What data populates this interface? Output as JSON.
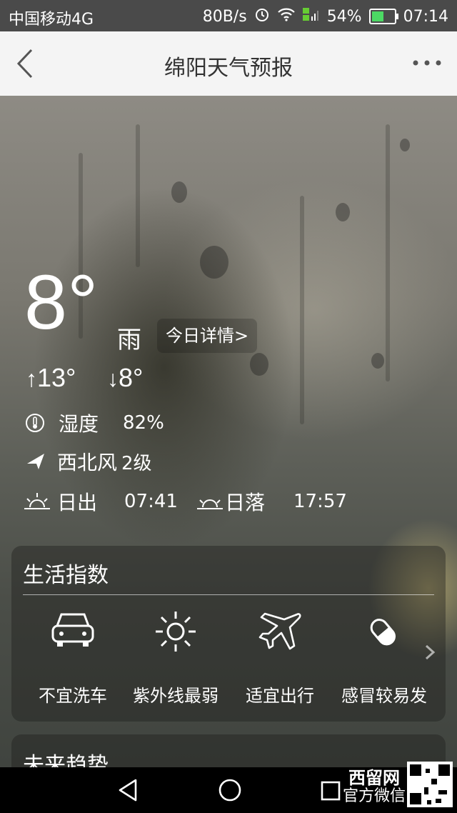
{
  "status_bar": {
    "carrier": "中国移动4G",
    "speed": "80B/s",
    "battery": "54%",
    "battery_level": 0.54,
    "time": "07:14"
  },
  "nav": {
    "title": "绵阳天气预报"
  },
  "weather": {
    "temperature": "8°",
    "condition": "雨",
    "detail_link": "今日详情>",
    "high": "13°",
    "low": "8°",
    "humidity_label": "湿度",
    "humidity_value": "82%",
    "wind": "西北风",
    "wind_level": "2级",
    "sunrise_label": "日出",
    "sunrise_time": "07:41",
    "sunset_label": "日落",
    "sunset_time": "17:57"
  },
  "life_index": {
    "title": "生活指数",
    "items": [
      {
        "label": "不宜洗车",
        "icon": "car-icon"
      },
      {
        "label": "紫外线最弱",
        "icon": "sun-icon"
      },
      {
        "label": "适宜出行",
        "icon": "airplane-icon"
      },
      {
        "label": "感冒较易发",
        "icon": "pill-icon"
      }
    ]
  },
  "trend": {
    "title": "未来趋势"
  },
  "watermark": {
    "name": "西留网",
    "sub": "官方微信"
  },
  "colors": {
    "nav_bg": "#f4f4f4",
    "status_bg": "#4a4a4a",
    "text": "#ffffff"
  }
}
